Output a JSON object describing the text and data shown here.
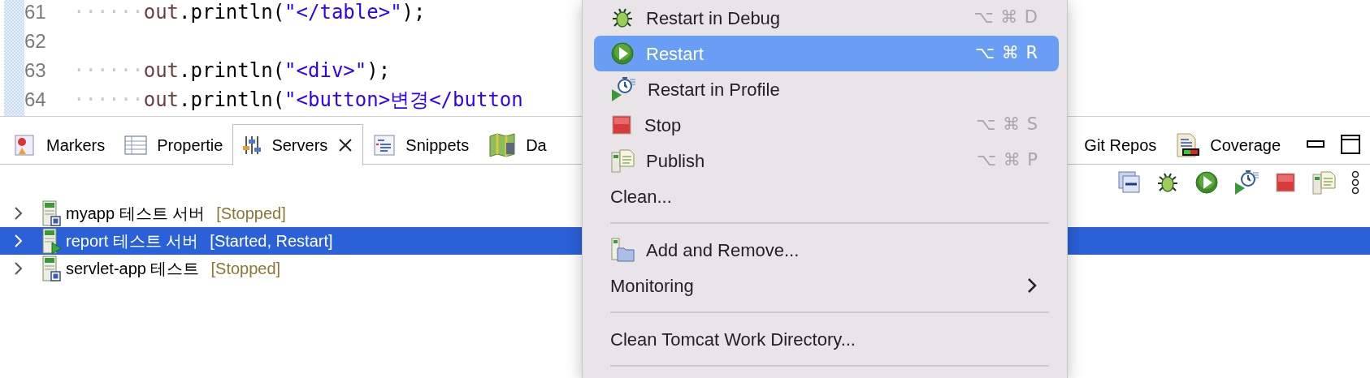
{
  "editor": {
    "lines": [
      {
        "number": "61",
        "tokens": [
          {
            "kind": "whitespace",
            "text": "······"
          },
          {
            "kind": "field",
            "text": "out"
          },
          {
            "kind": "plain",
            "text": ".println("
          },
          {
            "kind": "string",
            "text": "\"</table>\""
          },
          {
            "kind": "plain",
            "text": ");"
          }
        ]
      },
      {
        "number": "62"
      },
      {
        "number": "63",
        "tokens": [
          {
            "kind": "whitespace",
            "text": "······"
          },
          {
            "kind": "field",
            "text": "out"
          },
          {
            "kind": "plain",
            "text": ".println("
          },
          {
            "kind": "string",
            "text": "\"<div>\""
          },
          {
            "kind": "plain",
            "text": ");"
          }
        ]
      },
      {
        "number": "64",
        "tokens": [
          {
            "kind": "whitespace",
            "text": "······"
          },
          {
            "kind": "field",
            "text": "out"
          },
          {
            "kind": "plain",
            "text": ".println("
          },
          {
            "kind": "string",
            "text": "\"<button>변경</button"
          }
        ]
      }
    ]
  },
  "view_tabs": {
    "left": [
      {
        "label": "Markers",
        "kind": "markers",
        "selected": false,
        "closable": false
      },
      {
        "label": "Propertie",
        "kind": "properties",
        "selected": false,
        "closable": false
      },
      {
        "label": "Servers",
        "kind": "servers",
        "selected": true,
        "closable": true
      },
      {
        "label": "Snippets",
        "kind": "snippets",
        "selected": false,
        "closable": false
      },
      {
        "label": "Da",
        "kind": "data",
        "selected": false,
        "closable": false
      }
    ],
    "right": [
      {
        "label": "Git Repos",
        "selected": false,
        "closable": false
      },
      {
        "label": "Coverage",
        "kind": "coverage",
        "selected": false,
        "closable": false
      }
    ]
  },
  "servers": [
    {
      "name": "myapp 테스트 서버",
      "status": "[Stopped]",
      "kind": "stopped",
      "selected": false,
      "expanded": false
    },
    {
      "name": "report 테스트 서버",
      "status": "[Started, Restart]",
      "kind": "started",
      "selected": true,
      "expanded": false
    },
    {
      "name": "servlet-app 테스트",
      "status": "[Stopped]",
      "kind": "stopped",
      "selected": false,
      "expanded": false
    }
  ],
  "context_menu": {
    "items": [
      {
        "kind": "debug",
        "label": "Restart in Debug",
        "shortcut": "⌥ ⌘ D",
        "selected": false
      },
      {
        "kind": "run",
        "label": "Restart",
        "shortcut": "⌥ ⌘ R",
        "selected": true
      },
      {
        "kind": "profile",
        "label": "Restart in Profile",
        "selected": false
      },
      {
        "kind": "stop",
        "label": "Stop",
        "shortcut": "⌥ ⌘ S",
        "selected": false
      },
      {
        "kind": "publish",
        "label": "Publish",
        "shortcut": "⌥ ⌘ P",
        "selected": false
      },
      {
        "kind": "plain",
        "label": "Clean...",
        "selected": false
      },
      {
        "kind": "separator"
      },
      {
        "kind": "add-remove",
        "label": "Add and Remove...",
        "selected": false
      },
      {
        "kind": "submenu",
        "label": "Monitoring",
        "selected": false
      },
      {
        "kind": "separator"
      },
      {
        "kind": "plain",
        "label": "Clean Tomcat Work Directory...",
        "selected": false
      },
      {
        "kind": "separator"
      }
    ]
  }
}
